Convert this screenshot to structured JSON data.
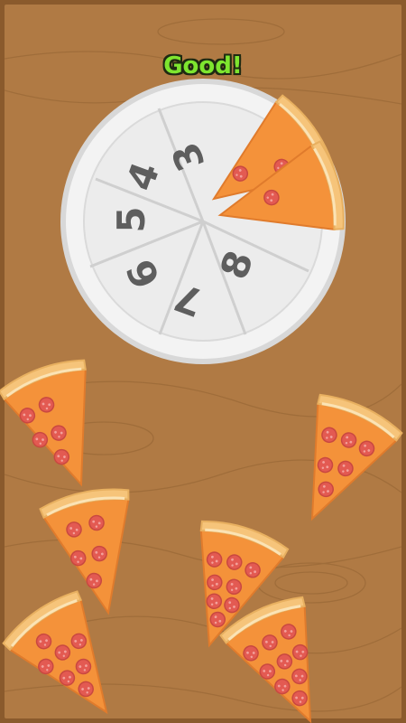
{
  "feedback": {
    "text": "Good!"
  },
  "plate": {
    "slot_labels": [
      "3",
      "4",
      "5",
      "6",
      "7",
      "8"
    ]
  },
  "colors": {
    "table": "#b07a44",
    "table_border": "#8a5a2c",
    "feedback": "#7ee52f",
    "plate": "#f1f1f1",
    "crust": "#f6c47a",
    "cheese": "#f4923a",
    "pepperoni": "#e35a52",
    "digit": "#5f5f5f"
  },
  "icons": [
    "pizza-slice-icon",
    "pepperoni-icon",
    "plate-icon"
  ],
  "loose_slices_count": 6
}
